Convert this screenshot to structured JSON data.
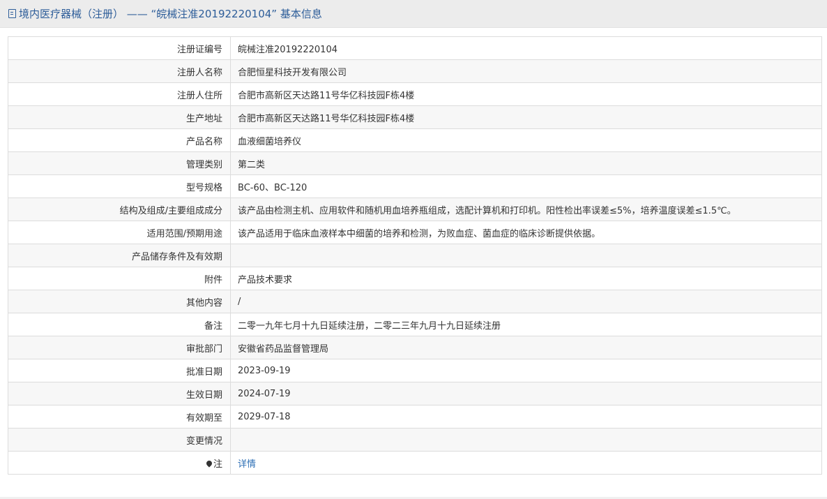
{
  "page": {
    "title": "境内医疗器械（注册） —— “皖械注准20192220104” 基本信息"
  },
  "rows": [
    {
      "label": "注册证编号",
      "value": "皖械注准20192220104"
    },
    {
      "label": "注册人名称",
      "value": "合肥恒星科技开发有限公司"
    },
    {
      "label": "注册人住所",
      "value": "合肥市高新区天达路11号华亿科技园F栋4楼"
    },
    {
      "label": "生产地址",
      "value": "合肥市高新区天达路11号华亿科技园F栋4楼"
    },
    {
      "label": "产品名称",
      "value": "血液细菌培养仪"
    },
    {
      "label": "管理类别",
      "value": "第二类"
    },
    {
      "label": "型号规格",
      "value": "BC-60、BC-120"
    },
    {
      "label": "结构及组成/主要组成成分",
      "value": "该产品由检测主机、应用软件和随机用血培养瓶组成，选配计算机和打印机。阳性检出率误差≤5%，培养温度误差≤1.5℃。"
    },
    {
      "label": "适用范围/预期用途",
      "value": "该产品适用于临床血液样本中细菌的培养和检测，为败血症、菌血症的临床诊断提供依据。"
    },
    {
      "label": "产品储存条件及有效期",
      "value": ""
    },
    {
      "label": "附件",
      "value": "产品技术要求"
    },
    {
      "label": "其他内容",
      "value": "/"
    },
    {
      "label": "备注",
      "value": "二零一九年七月十九日延续注册，二零二三年九月十九日延续注册"
    },
    {
      "label": "审批部门",
      "value": "安徽省药品监督管理局"
    },
    {
      "label": "批准日期",
      "value": "2023-09-19"
    },
    {
      "label": "生效日期",
      "value": "2024-07-19"
    },
    {
      "label": "有效期至",
      "value": "2029-07-18"
    },
    {
      "label": "变更情况",
      "value": ""
    }
  ],
  "note_row": {
    "label": "注",
    "link_text": "详情",
    "icon": "pin-icon"
  },
  "colors": {
    "title_text": "#2d5d99",
    "link": "#2d6fb5",
    "border": "#dcdcdc",
    "stripe": "#f7f7f7"
  }
}
